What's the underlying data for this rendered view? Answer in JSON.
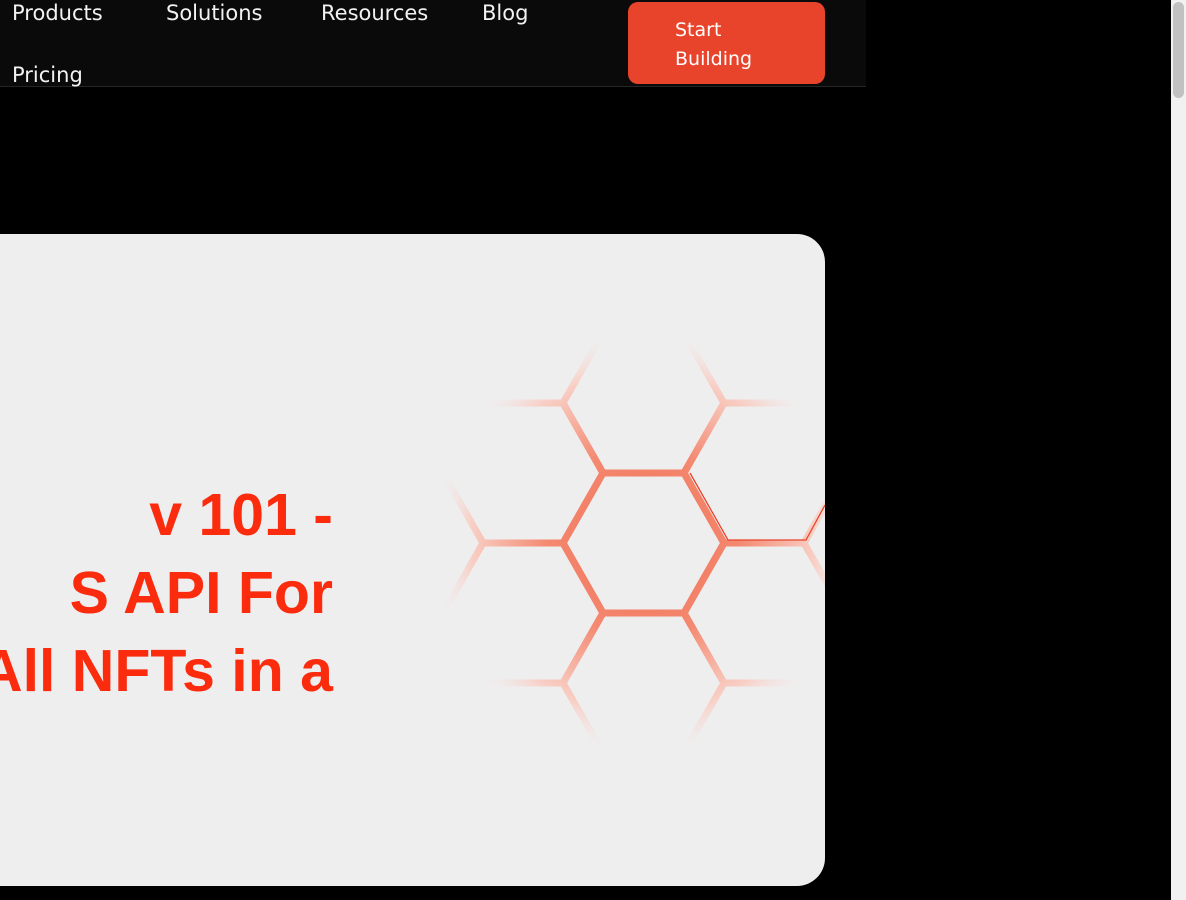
{
  "nav": {
    "links": [
      {
        "label": "Products"
      },
      {
        "label": "Solutions"
      },
      {
        "label": "Resources"
      },
      {
        "label": "Blog"
      },
      {
        "label": "Pricing"
      }
    ],
    "cta_label": "Start Building"
  },
  "hero": {
    "title_lines": [
      "v 101 -",
      "S API For",
      "All NFTs in a"
    ],
    "icon": "hexagon-pattern"
  },
  "colors": {
    "accent": "#e8432b",
    "headline": "#fb2b0d",
    "card": "#efeeef",
    "background": "#000000",
    "nav": "#0a0a0a"
  }
}
